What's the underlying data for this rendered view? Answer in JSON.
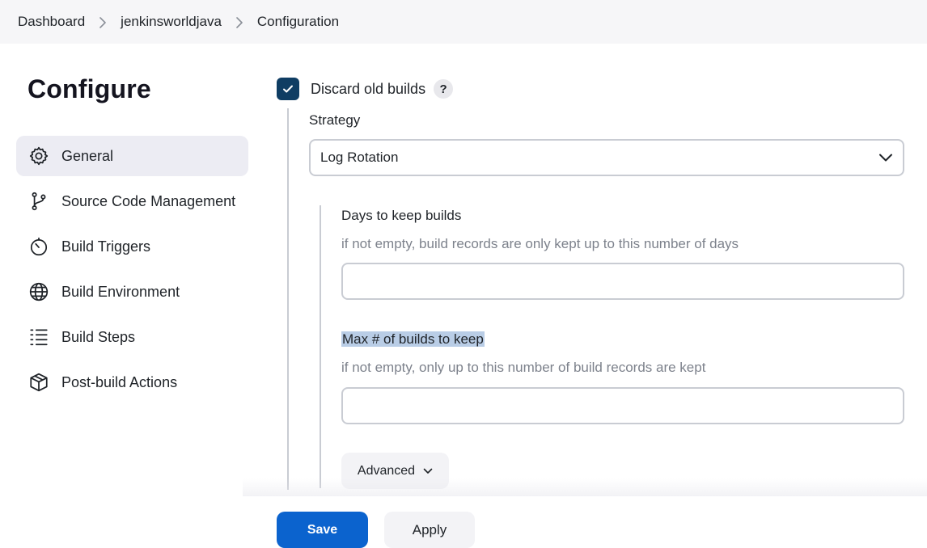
{
  "breadcrumb": {
    "items": [
      "Dashboard",
      "jenkinsworldjava",
      "Configuration"
    ]
  },
  "sidebar": {
    "title": "Configure",
    "items": [
      {
        "label": "General",
        "icon": "gear-icon",
        "active": true
      },
      {
        "label": "Source Code Management",
        "icon": "git-branch-icon",
        "active": false
      },
      {
        "label": "Build Triggers",
        "icon": "timer-icon",
        "active": false
      },
      {
        "label": "Build Environment",
        "icon": "globe-icon",
        "active": false
      },
      {
        "label": "Build Steps",
        "icon": "list-steps-icon",
        "active": false
      },
      {
        "label": "Post-build Actions",
        "icon": "package-icon",
        "active": false
      }
    ]
  },
  "main": {
    "discard_old_builds": {
      "label": "Discard old builds",
      "checked": true,
      "help": "?"
    },
    "strategy": {
      "label": "Strategy",
      "selected": "Log Rotation"
    },
    "days_to_keep": {
      "label": "Days to keep builds",
      "description": "if not empty, build records are only kept up to this number of days",
      "value": ""
    },
    "max_builds": {
      "label": "Max # of builds to keep",
      "description": "if not empty, only up to this number of build records are kept",
      "value": ""
    },
    "advanced_label": "Advanced"
  },
  "actions": {
    "save_label": "Save",
    "apply_label": "Apply"
  },
  "colors": {
    "accent": "#0b63ce",
    "checkbox": "#0f3d63",
    "active_nav": "#ececf3",
    "selection_highlight": "#b9cde6"
  }
}
